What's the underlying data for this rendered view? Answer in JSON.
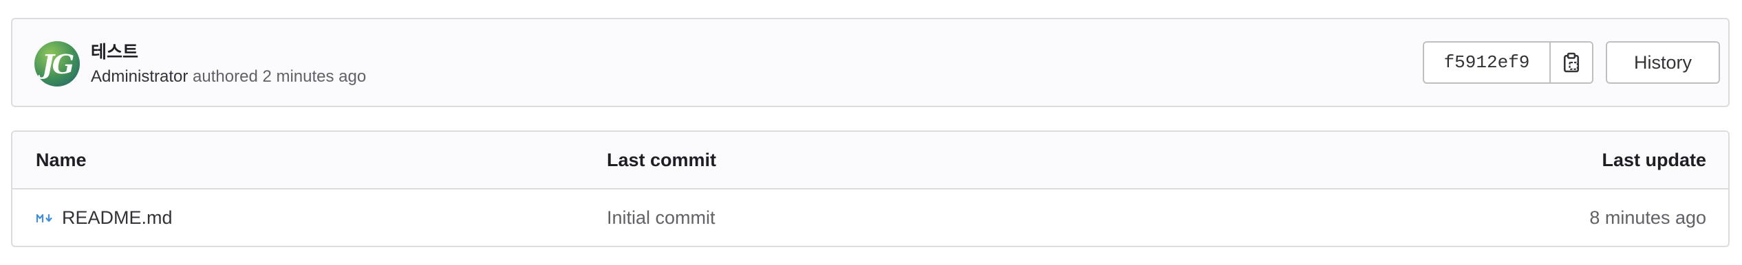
{
  "commit": {
    "title": "테스트",
    "author": "Administrator",
    "meta_suffix": " authored 2 minutes ago",
    "avatar_initials": "JG",
    "sha": "f5912ef9",
    "copy_icon": "clipboard-icon",
    "history_label": "History"
  },
  "table": {
    "headers": {
      "name": "Name",
      "last_commit": "Last commit",
      "last_update": "Last update"
    },
    "rows": [
      {
        "icon": "markdown-icon",
        "name": "README.md",
        "last_commit": "Initial commit",
        "last_update": "8 minutes ago"
      }
    ]
  },
  "colors": {
    "markdown_icon": "#428fdc",
    "border": "#dcdcde",
    "header_bg": "#fbfafd"
  }
}
